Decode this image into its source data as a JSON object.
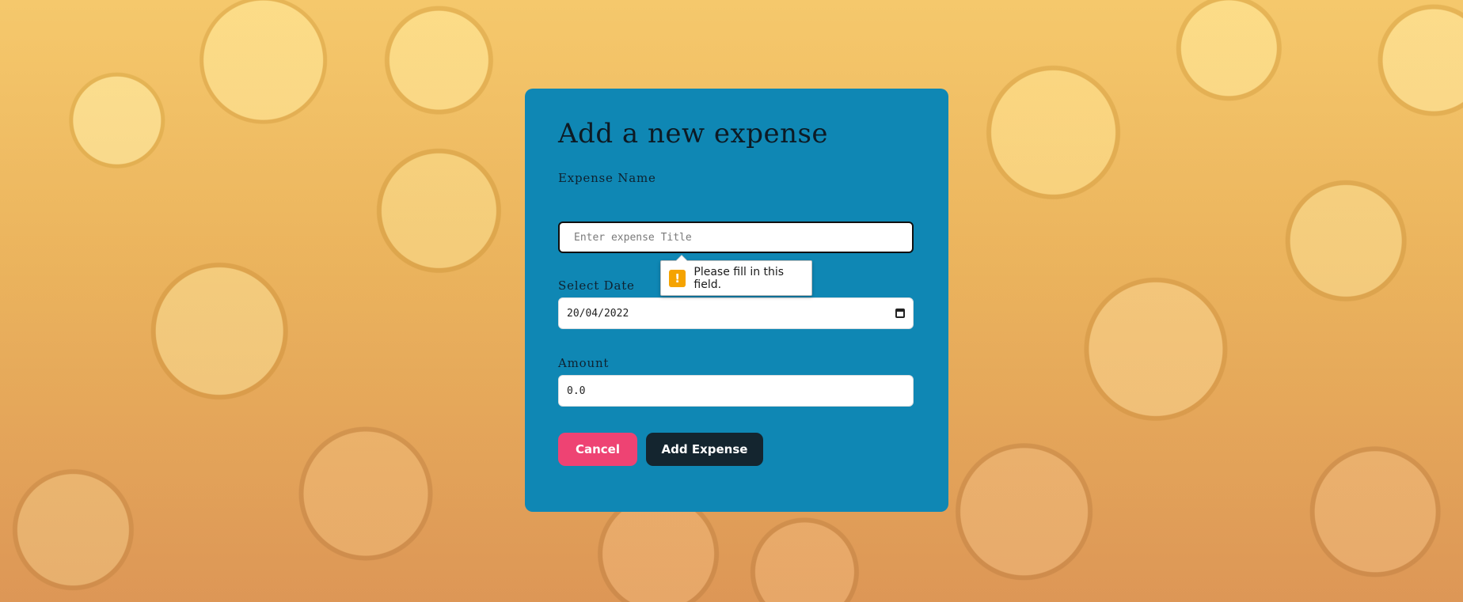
{
  "form": {
    "title": "Add a new expense",
    "expense_name": {
      "label": "Expense Name",
      "placeholder": "Enter expense Title",
      "value": ""
    },
    "date": {
      "label": "Select Date",
      "value": "20/04/2022",
      "icon": "calendar-icon"
    },
    "amount": {
      "label": "Amount",
      "value": "0.0"
    },
    "buttons": {
      "cancel_label": "Cancel",
      "add_label": "Add Expense"
    }
  },
  "validation": {
    "icon_glyph": "!",
    "message": "Please fill in this field."
  },
  "colors": {
    "card": "#0f87b4",
    "cancel": "#ee4373",
    "add": "#14252f",
    "warning": "#f5a300"
  }
}
